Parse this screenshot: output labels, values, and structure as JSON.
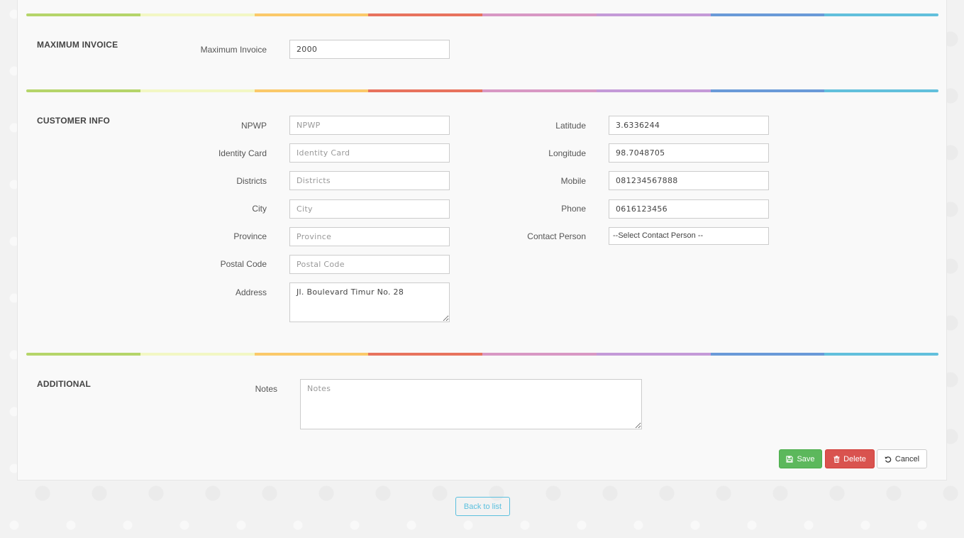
{
  "colors": {
    "rainbow": [
      "#b5d56a",
      "#f2f7c4",
      "#fbc96a",
      "#e8735e",
      "#d898c4",
      "#c49ad8",
      "#6a9ad8",
      "#62c0dc"
    ],
    "save": "#5cb85c",
    "delete": "#d9534f",
    "back": "#5bc0de"
  },
  "max_invoice": {
    "title": "MAXIMUM INVOICE",
    "label": "Maximum Invoice",
    "value": "2000"
  },
  "customer_info": {
    "title": "CUSTOMER INFO",
    "npwp": {
      "label": "NPWP",
      "placeholder": "NPWP",
      "value": ""
    },
    "identity_card": {
      "label": "Identity Card",
      "placeholder": "Identity Card",
      "value": ""
    },
    "districts": {
      "label": "Districts",
      "placeholder": "Districts",
      "value": ""
    },
    "city": {
      "label": "City",
      "placeholder": "City",
      "value": ""
    },
    "province": {
      "label": "Province",
      "placeholder": "Province",
      "value": ""
    },
    "postal_code": {
      "label": "Postal Code",
      "placeholder": "Postal Code",
      "value": ""
    },
    "address": {
      "label": "Address",
      "value": "Jl. Boulevard Timur No. 28"
    },
    "latitude": {
      "label": "Latitude",
      "value": "3.6336244"
    },
    "longitude": {
      "label": "Longitude",
      "value": "98.7048705"
    },
    "mobile": {
      "label": "Mobile",
      "value": "081234567888"
    },
    "phone": {
      "label": "Phone",
      "value": "0616123456"
    },
    "contact_person": {
      "label": "Contact Person",
      "selected": "--Select Contact Person --"
    }
  },
  "additional": {
    "title": "ADDITIONAL",
    "notes": {
      "label": "Notes",
      "placeholder": "Notes",
      "value": ""
    }
  },
  "actions": {
    "save": "Save",
    "delete": "Delete",
    "cancel": "Cancel",
    "back": "Back to list"
  }
}
